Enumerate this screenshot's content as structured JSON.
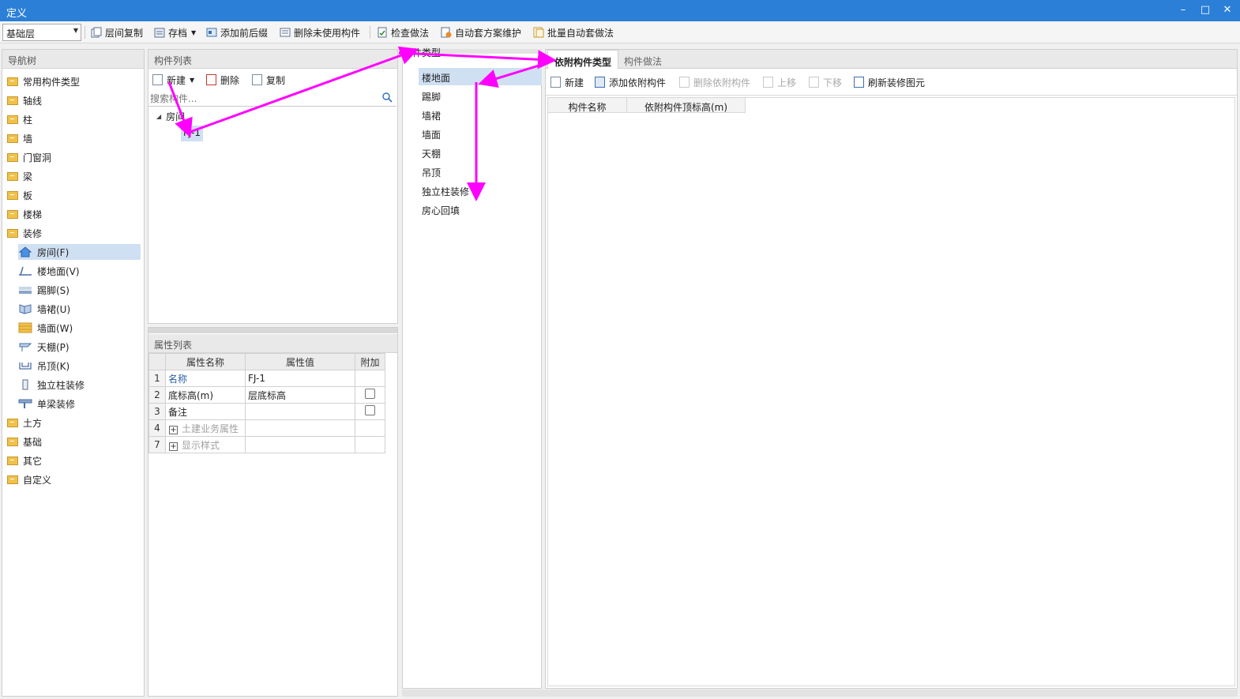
{
  "window": {
    "title": "定义",
    "minimize": "–",
    "maximize": "□",
    "close": "✕"
  },
  "toolbar": {
    "floor": "基础层",
    "items": [
      "层间复制",
      "存档",
      "添加前后缀",
      "删除未使用构件",
      "检查做法",
      "自动套方案维护",
      "批量自动套做法"
    ]
  },
  "nav": {
    "title": "导航树",
    "groups": [
      "常用构件类型",
      "轴线",
      "柱",
      "墙",
      "门窗洞",
      "梁",
      "板",
      "楼梯",
      "装修"
    ],
    "children": [
      "房间(F)",
      "楼地面(V)",
      "踢脚(S)",
      "墙裙(U)",
      "墙面(W)",
      "天棚(P)",
      "吊顶(K)",
      "独立柱装修",
      "单梁装修"
    ],
    "groups2": [
      "土方",
      "基础",
      "其它",
      "自定义"
    ]
  },
  "comp_list": {
    "title": "构件列表",
    "new": "新建",
    "delete": "删除",
    "copy": "复制",
    "search_placeholder": "搜索构件...",
    "tree_root": "房间",
    "tree_child": "FJ-1"
  },
  "props": {
    "title": "属性列表",
    "headers": [
      "属性名称",
      "属性值",
      "附加"
    ],
    "rows": [
      {
        "num": "1",
        "name": "名称",
        "value": "FJ-1"
      },
      {
        "num": "2",
        "name": "底标高(m)",
        "value": "层底标高"
      },
      {
        "num": "3",
        "name": "备注",
        "value": ""
      },
      {
        "num": "4",
        "name": "土建业务属性",
        "value": ""
      },
      {
        "num": "7",
        "name": "显示样式",
        "value": ""
      }
    ]
  },
  "comp_type": {
    "title": "构件类型",
    "items": [
      "楼地面",
      "踢脚",
      "墙裙",
      "墙面",
      "天棚",
      "吊顶",
      "独立柱装修",
      "房心回填"
    ]
  },
  "right": {
    "tabs": [
      "依附构件类型",
      "构件做法"
    ],
    "toolbar": [
      "新建",
      "添加依附构件",
      "删除依附构件",
      "上移",
      "下移",
      "刷新装修图元"
    ],
    "columns": [
      "构件名称",
      "依附构件顶标高(m)"
    ]
  },
  "colors": {
    "accent": "#2b7fd7",
    "annotation": "#ff00ff",
    "selection": "#cfe0f3"
  }
}
